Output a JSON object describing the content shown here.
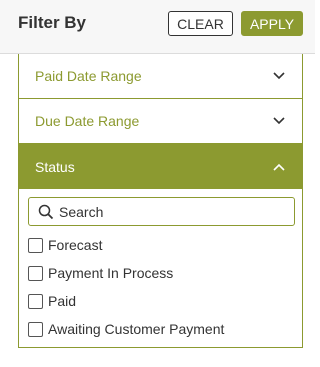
{
  "header": {
    "title": "Filter By",
    "clear_label": "CLEAR",
    "apply_label": "APPLY"
  },
  "sections": {
    "paid_date": {
      "label": "Paid Date Range",
      "icon": "chevron-down-icon",
      "expanded": false
    },
    "due_date": {
      "label": "Due Date Range",
      "icon": "chevron-down-icon",
      "expanded": false
    },
    "status": {
      "label": "Status",
      "icon": "chevron-up-icon",
      "expanded": true
    }
  },
  "search": {
    "placeholder": "Search",
    "value": "",
    "icon": "search-icon"
  },
  "status_options": [
    {
      "label": "Forecast",
      "checked": false
    },
    {
      "label": "Payment In Process",
      "checked": false
    },
    {
      "label": "Paid",
      "checked": false
    },
    {
      "label": "Awaiting Customer Payment",
      "checked": false
    }
  ],
  "colors": {
    "accent": "#8c9a30",
    "header_bg": "#f7f7f7",
    "text": "#333333"
  }
}
